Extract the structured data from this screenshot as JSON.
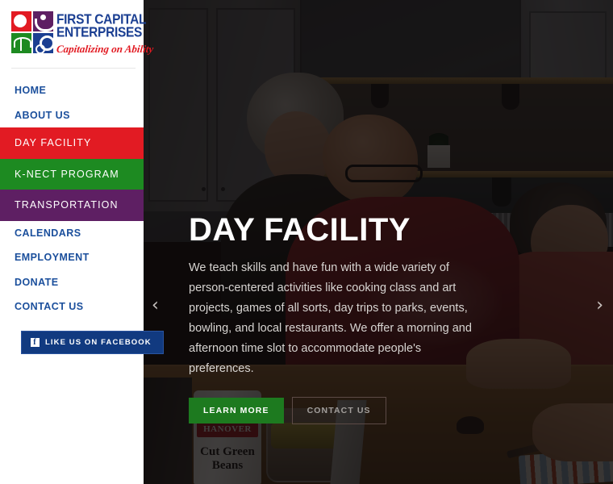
{
  "brand": {
    "line1": "FIRST CAPITAL",
    "line2": "ENTERPRISES",
    "tagline": "Capitalizing on Ability",
    "colors": {
      "red": "#e21b23",
      "purple": "#5e1f63",
      "green": "#1d8a21",
      "blue": "#1b3f92"
    }
  },
  "sidebar": {
    "nav": [
      {
        "label": "HOME",
        "style": "plain"
      },
      {
        "label": "ABOUT US",
        "style": "plain"
      },
      {
        "label": "DAY FACILITY",
        "style": "bar-red"
      },
      {
        "label": "K-NECT PROGRAM",
        "style": "bar-green"
      },
      {
        "label": "TRANSPORTATION",
        "style": "bar-purple"
      },
      {
        "label": "CALENDARS",
        "style": "plain"
      },
      {
        "label": "EMPLOYMENT",
        "style": "plain"
      },
      {
        "label": "DONATE",
        "style": "plain"
      },
      {
        "label": "CONTACT US",
        "style": "plain"
      }
    ],
    "facebook_button": {
      "label": "LIKE US ON FACEBOOK",
      "glyph": "f",
      "bg": "#113a80"
    }
  },
  "hero": {
    "title": "DAY FACILITY",
    "paragraph": "We teach skills and have fun with a wide variety of person-centered activities like cooking class and art projects, games of all sorts, day trips to parks, events, bowling, and local restaurants. We offer a morning and afternoon time slot to accommodate people's preferences.",
    "primary_button": "LEARN MORE",
    "secondary_button": "CONTACT US",
    "prev_arrow": "‹",
    "next_arrow": "›",
    "photo_text": {
      "can_brand": "HANOVER",
      "can_product": "Cut Green Beans"
    }
  }
}
